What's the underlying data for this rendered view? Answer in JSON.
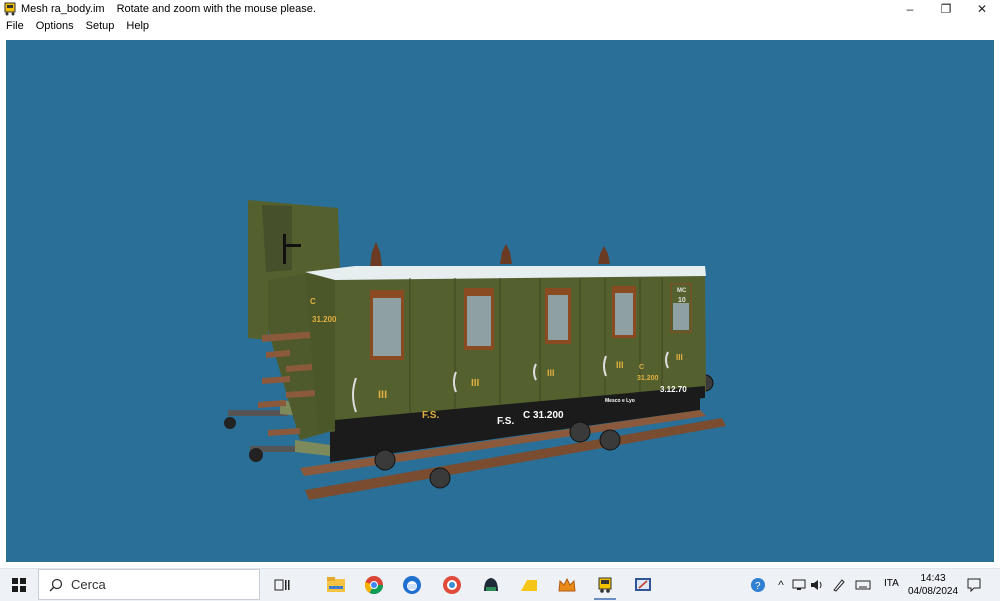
{
  "window": {
    "title": "Mesh ra_body.im",
    "hint": "Rotate and zoom with the mouse please.",
    "controls": {
      "minimize": "–",
      "restore": "❐",
      "close": "✕"
    }
  },
  "menu": {
    "items": [
      "File",
      "Options",
      "Setup",
      "Help"
    ]
  },
  "model": {
    "markings": {
      "end_class": "C",
      "end_number": "31.200",
      "side_fs": "F.S.",
      "reporting_mark": "F.S.",
      "car_number": "C 31.200",
      "class_numeral": "III",
      "small_text": "Mesco e Lyo",
      "weight_code": "3.12.70",
      "door_code": "MC",
      "door_number": "10",
      "side_class": "C",
      "side_number": "31.200"
    },
    "colors": {
      "body": "#55602f",
      "roof": "#e6eef0",
      "window_frame": "#8a4a22",
      "planks": "#8b5a3c"
    }
  },
  "taskbar": {
    "search_placeholder": "Cerca",
    "apps": [
      "task-view",
      "separator",
      "file-explorer",
      "chrome",
      "thunderbird",
      "vivaldi",
      "app-green",
      "app-yellow",
      "app-crown",
      "train-app",
      "editor-app"
    ],
    "tray": {
      "language": "ITA",
      "time": "14:43",
      "date": "04/08/2024"
    }
  }
}
